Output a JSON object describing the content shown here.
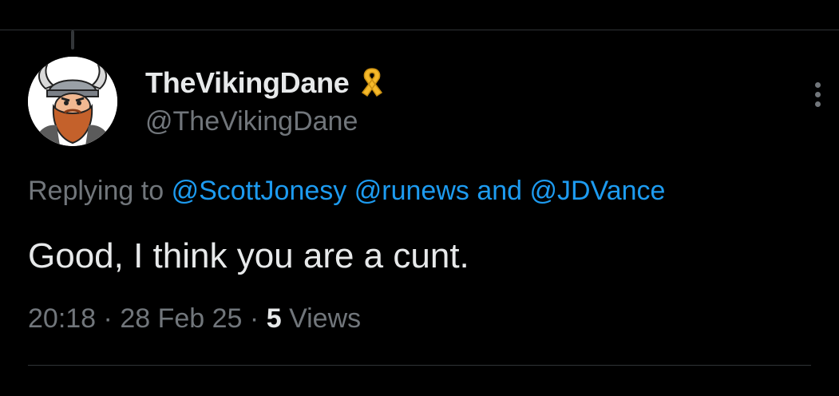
{
  "tweet": {
    "author": {
      "display_name": "TheVikingDane",
      "handle": "@TheVikingDane",
      "badge_icon": "yellow-ribbon-icon",
      "avatar_icon": "viking-avatar"
    },
    "replying_to": {
      "prefix": "Replying to",
      "mentions": [
        "@ScottJonesy",
        "@runews",
        "@JDVance"
      ],
      "conjunction": "and"
    },
    "text": "Good, I think you are a cunt.",
    "meta": {
      "time": "20:18",
      "separator": "·",
      "date": "28 Feb 25",
      "views_count": "5",
      "views_label": "Views"
    },
    "more_icon": "more-vertical-icon"
  },
  "colors": {
    "background": "#000000",
    "primary_text": "#e7e9ea",
    "secondary_text": "#71767b",
    "link": "#1d9bf0",
    "divider": "#2f3336",
    "ribbon": "#f5b92a"
  }
}
